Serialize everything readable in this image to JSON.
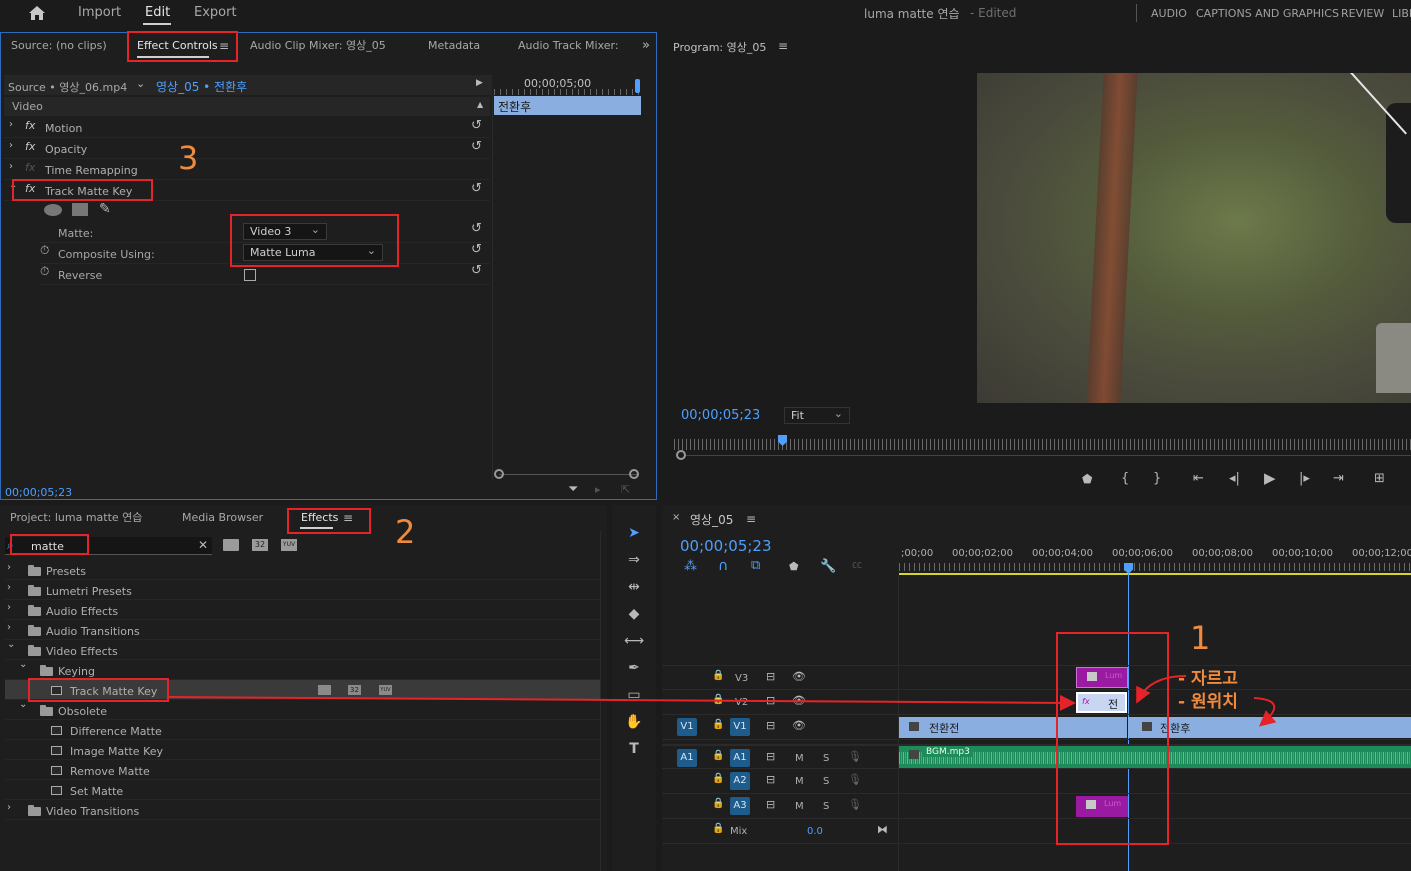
{
  "menubar": {
    "items": [
      "Import",
      "Edit",
      "Export"
    ],
    "project_title": "luma matte 연습",
    "edited": "- Edited",
    "workspaces": [
      "AUDIO",
      "CAPTIONS AND GRAPHICS",
      "REVIEW",
      "LIBR"
    ]
  },
  "source_panel": {
    "tabs": [
      "Source: (no clips)",
      "Effect Controls",
      "Audio Clip Mixer: 영상_05",
      "Metadata",
      "Audio Track Mixer: 영"
    ],
    "source_label": "Source • 영상_06.mp4",
    "sequence_clip": "영상_05 • 전환후",
    "timeline_time": "00;00;05;00",
    "clip_label": "전환후",
    "video_label": "Video",
    "effects": [
      "Motion",
      "Opacity",
      "Time Remapping",
      "Track Matte Key"
    ],
    "matte_label": "Matte:",
    "matte_value": "Video 3",
    "composite_label": "Composite Using:",
    "composite_value": "Matte Luma",
    "reverse_label": "Reverse",
    "timecode": "00;00;05;23"
  },
  "program_panel": {
    "title": "Program: 영상_05",
    "timecode": "00;00;05;23",
    "fit": "Fit"
  },
  "project_panel": {
    "tabs": [
      "Project: luma matte 연습",
      "Media Browser",
      "Effects"
    ],
    "search_value": "matte",
    "icon_labels": [
      "32",
      "YUV"
    ],
    "tree": [
      {
        "label": "Presets",
        "type": "preset",
        "level": 0,
        "expanded": false
      },
      {
        "label": "Lumetri Presets",
        "type": "preset",
        "level": 0,
        "expanded": false
      },
      {
        "label": "Audio Effects",
        "type": "folder",
        "level": 0,
        "expanded": false
      },
      {
        "label": "Audio Transitions",
        "type": "folder",
        "level": 0,
        "expanded": false
      },
      {
        "label": "Video Effects",
        "type": "folder",
        "level": 0,
        "expanded": true
      },
      {
        "label": "Keying",
        "type": "folder",
        "level": 1,
        "expanded": true
      },
      {
        "label": "Track Matte Key",
        "type": "effect",
        "level": 2,
        "selected": true
      },
      {
        "label": "Obsolete",
        "type": "folder",
        "level": 1,
        "expanded": true
      },
      {
        "label": "Difference Matte",
        "type": "effect",
        "level": 2
      },
      {
        "label": "Image Matte Key",
        "type": "effect",
        "level": 2
      },
      {
        "label": "Remove Matte",
        "type": "effect",
        "level": 2
      },
      {
        "label": "Set Matte",
        "type": "effect",
        "level": 2
      },
      {
        "label": "Video Transitions",
        "type": "folder",
        "level": 0,
        "expanded": false
      }
    ]
  },
  "timeline": {
    "title": "영상_05",
    "timecode": "00;00;05;23",
    "ruler": [
      ";00;00",
      "00;00;02;00",
      "00;00;04;00",
      "00;00;06;00",
      "00;00;08;00",
      "00;00;10;00",
      "00;00;12;00"
    ],
    "tracks": {
      "v3": "V3",
      "v2": "V2",
      "v1": "V1",
      "a1": "A1",
      "a2": "A2",
      "a3": "A3",
      "mix": "Mix",
      "mix_value": "0.0",
      "m": "M",
      "s": "S"
    },
    "clips": {
      "before": "전환전",
      "after": "전환후",
      "bgm": "BGM.mp3",
      "lum": "Lum",
      "v2_clip": "전"
    }
  },
  "annotations": {
    "num1": "1",
    "num2": "2",
    "num3": "3",
    "note_line1": "- 자르고",
    "note_line2": "- 원위치"
  },
  "colors": {
    "accent_blue": "#4f9fff",
    "highlight_red": "#e5242a",
    "annotation_orange": "#f08a3c",
    "clip_blue": "#8aaee0",
    "clip_purple": "#9a1aa2",
    "audio_green": "#1e8c5a"
  }
}
